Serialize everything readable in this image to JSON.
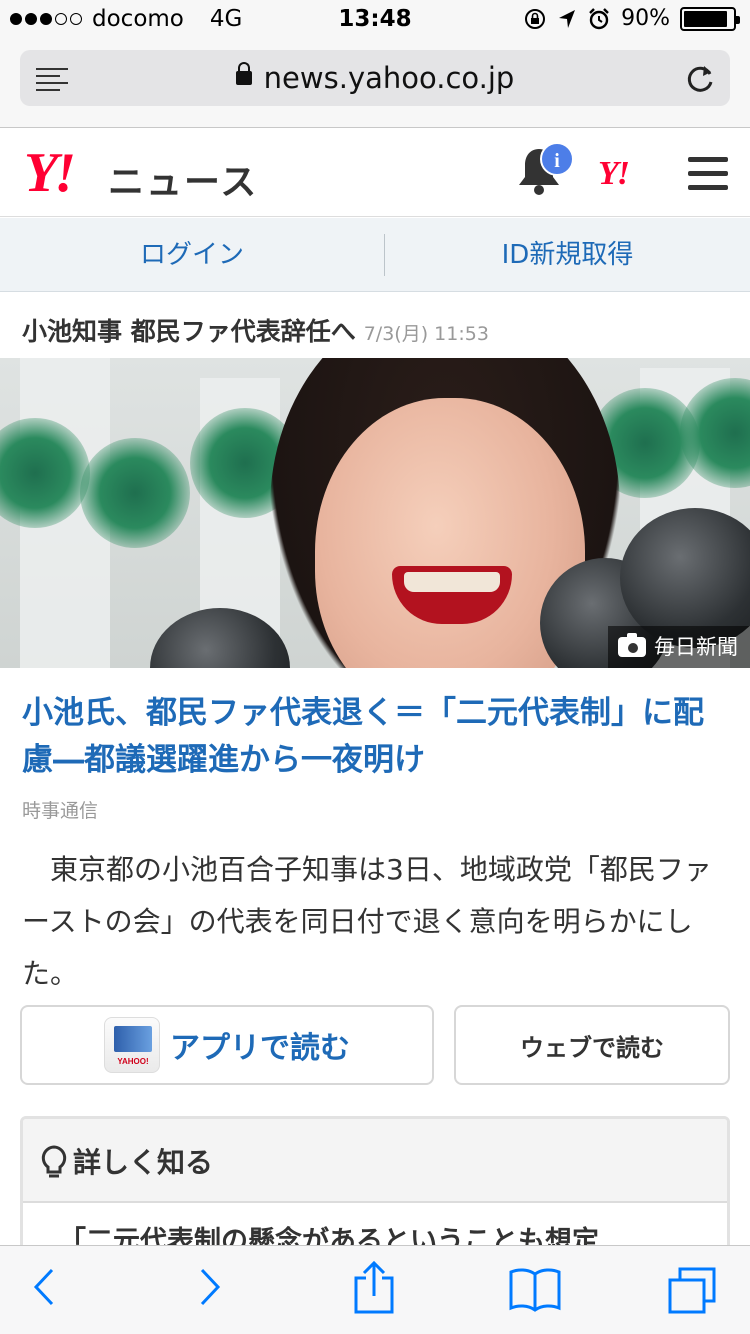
{
  "status_bar": {
    "carrier": "docomo",
    "network": "4G",
    "time": "13:48",
    "battery": "90%",
    "battery_level": 0.9,
    "signal_bars": 3
  },
  "browser": {
    "url": "news.yahoo.co.jp"
  },
  "site": {
    "logo_mark": "Y!",
    "logo_text": "ニュース",
    "notification_badge": "i",
    "yjapan_mark": "Y!"
  },
  "auth": {
    "login_label": "ログイン",
    "signup_label": "ID新規取得"
  },
  "topic": {
    "title": "小池知事 都民ファ代表辞任へ",
    "date": "7/3(月) 11:53"
  },
  "photo": {
    "credit": "毎日新聞"
  },
  "article": {
    "headline": "小池氏、都民ファ代表退く＝「二元代表制」に配慮―都議選躍進から一夜明け",
    "source": "時事通信",
    "body": "東京都の小池百合子知事は3日、地域政党「都民ファーストの会」の代表を同日付で退く意向を明らかにした。"
  },
  "read_buttons": {
    "app_icon_label": "YAHOO!",
    "app_label": "アプリで読む",
    "web_label": "ウェブで読む"
  },
  "more": {
    "heading": "詳しく知る",
    "first_item": "「二元代表制の懸念があるということも想定"
  },
  "colors": {
    "link_blue": "#1e6ab7",
    "yahoo_red": "#ff0033",
    "badge_blue": "#4d7ee8",
    "ios_blue": "#007aff"
  },
  "icons": {
    "reader": "reader-mode-icon",
    "lock": "lock-icon",
    "reload": "reload-icon",
    "bell": "bell-icon",
    "menu": "hamburger-menu-icon",
    "camera": "camera-icon",
    "bulb": "lightbulb-icon",
    "back": "back-arrow-icon",
    "forward": "forward-arrow-icon",
    "share": "share-icon",
    "bookmarks": "bookmarks-icon",
    "tabs": "tabs-icon"
  }
}
